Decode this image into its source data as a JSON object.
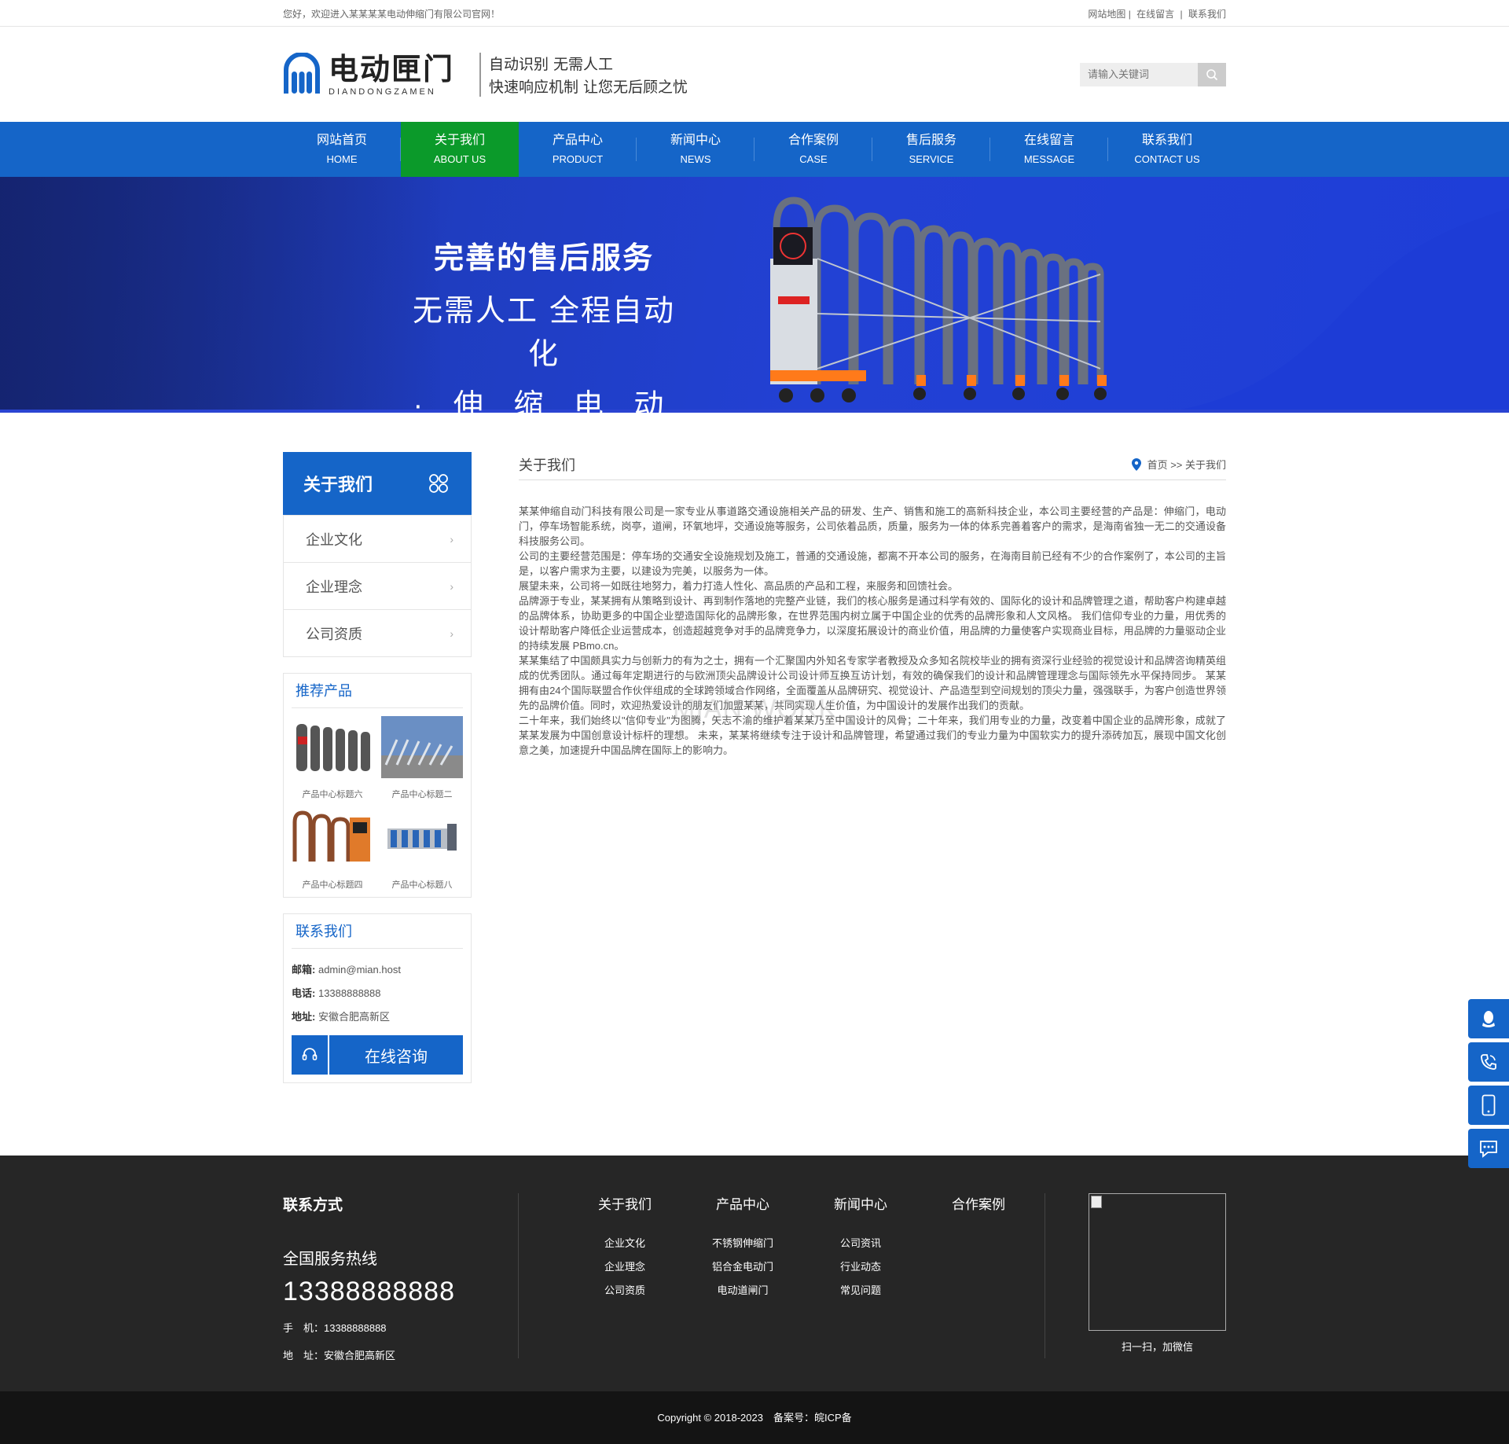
{
  "topbar": {
    "welcome": "您好，欢迎进入某某某某电动伸缩门有限公司官网！",
    "links": [
      "网站地图 |",
      "在线留言",
      "|",
      "联系我们"
    ]
  },
  "header": {
    "logo_title": "电动匣门",
    "logo_sub": "DIANDONGZAMEN",
    "slogan1": "自动识别 无需人工",
    "slogan2": "快速响应机制 让您无后顾之忧",
    "search_placeholder": "请输入关键词"
  },
  "nav": [
    {
      "cn": "网站首页",
      "en": "HOME"
    },
    {
      "cn": "关于我们",
      "en": "ABOUT US"
    },
    {
      "cn": "产品中心",
      "en": "PRODUCT"
    },
    {
      "cn": "新闻中心",
      "en": "NEWS"
    },
    {
      "cn": "合作案例",
      "en": "CASE"
    },
    {
      "cn": "售后服务",
      "en": "SERVICE"
    },
    {
      "cn": "在线留言",
      "en": "MESSAGE"
    },
    {
      "cn": "联系我们",
      "en": "CONTACT US"
    }
  ],
  "banner": {
    "line1": "完善的售后服务",
    "line2": "无需人工 全程自动化",
    "line3": "· 伸 缩 电 动 门 ·"
  },
  "sidebar": {
    "title": "关于我们",
    "menu": [
      "企业文化",
      "企业理念",
      "公司资质"
    ],
    "products_title": "推荐产品",
    "products": [
      "产品中心标题六",
      "产品中心标题二",
      "产品中心标题四",
      "产品中心标题八"
    ],
    "contact_title": "联系我们",
    "email_label": "邮箱:",
    "email": "admin@mian.host",
    "phone_label": "电话:",
    "phone": "13388888888",
    "address_label": "地址:",
    "address": "安徽合肥高新区",
    "consult": "在线咨询"
  },
  "content": {
    "title": "关于我们",
    "crumb": "首页 >> 关于我们",
    "watermark": "MIAN WORK",
    "paragraphs": [
      "某某伸缩自动门科技有限公司是一家专业从事道路交通设施相关产品的研发、生产、销售和施工的高新科技企业，本公司主要经营的产品是：伸缩门，电动门，停车场智能系统，岗亭，道闸，环氧地坪，交通设施等服务，公司依着品质，质量，服务为一体的体系完善着客户的需求，是海南省独一无二的交通设备科技服务公司。",
      "公司的主要经营范围是：停车场的交通安全设施规划及施工，普通的交通设施，都离不开本公司的服务，在海南目前已经有不少的合作案例了，本公司的主旨是，以客户需求为主要，以建设为完美，以服务为一体。",
      "展望未来，公司将一如既往地努力，着力打造人性化、高品质的产品和工程，来服务和回馈社会。",
      "品牌源于专业，某某拥有从策略到设计、再到制作落地的完整产业链，我们的核心服务是通过科学有效的、国际化的设计和品牌管理之道，帮助客户构建卓越的品牌体系，协助更多的中国企业塑造国际化的品牌形象，在世界范围内树立属于中国企业的优秀的品牌形象和人文风格。 我们信仰专业的力量，用优秀的设计帮助客户降低企业运营成本，创造超越竞争对手的品牌竞争力，以深度拓展设计的商业价值，用品牌的力量使客户实现商业目标，用品牌的力量驱动企业的持续发展 PBmo.cn。",
      "某某集结了中国颇具实力与创新力的有为之士，拥有一个汇聚国内外知名专家学者教授及众多知名院校毕业的拥有资深行业经验的视觉设计和品牌咨询精英组成的优秀团队。通过每年定期进行的与欧洲顶尖品牌设计公司设计师互换互访计划，有效的确保我们的设计和品牌管理理念与国际领先水平保持同步。 某某拥有由24个国际联盟合作伙伴组成的全球跨领域合作网络，全面覆盖从品牌研究、视觉设计、产品造型到空间规划的顶尖力量，强强联手，为客户创造世界领先的品牌价值。同时，欢迎热爱设计的朋友们加盟某某，共同实现人生价值，为中国设计的发展作出我们的贡献。",
      "二十年来，我们始终以\"信仰专业\"为图腾，矢志不渝的维护着某某乃至中国设计的风骨；二十年来，我们用专业的力量，改变着中国企业的品牌形象，成就了某某发展为中国创意设计标杆的理想。 未来，某某将继续专注于设计和品牌管理，希望通过我们的专业力量为中国软实力的提升添砖加瓦，展现中国文化创意之美，加速提升中国品牌在国际上的影响力。"
    ]
  },
  "side_tools": [
    "qq-icon",
    "phone-icon",
    "mobile-icon",
    "chat-icon"
  ],
  "footer": {
    "contact_title": "联系方式",
    "hotline_label": "全国服务热线",
    "hotline": "13388888888",
    "mobile": "手　机：13388888888",
    "address": "地　址：安徽合肥高新区",
    "cols": [
      {
        "title": "关于我们",
        "items": [
          "企业文化",
          "企业理念",
          "公司资质"
        ]
      },
      {
        "title": "产品中心",
        "items": [
          "不锈钢伸缩门",
          "铝合金电动门",
          "电动道闸门"
        ]
      },
      {
        "title": "新闻中心",
        "items": [
          "公司资讯",
          "行业动态",
          "常见问题"
        ]
      },
      {
        "title": "合作案例",
        "items": []
      }
    ],
    "qr_caption": "扫一扫，加微信",
    "copyright": "Copyright © 2018-2023　备案号：皖ICP备"
  },
  "colors": {
    "primary": "#1565c8",
    "active": "#0b9a2a",
    "footer": "#262626",
    "copyright": "#141414"
  }
}
